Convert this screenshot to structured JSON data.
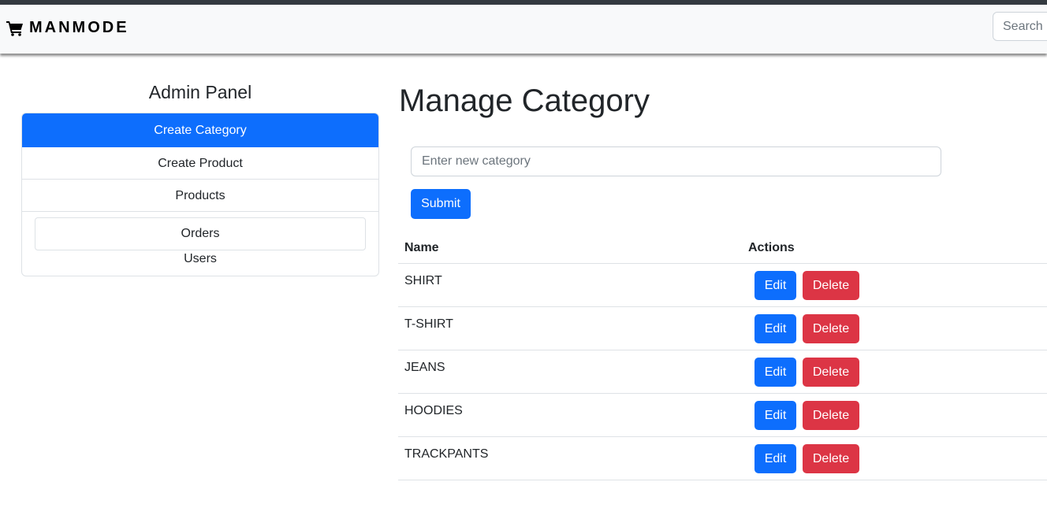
{
  "navbar": {
    "brand": "MANMODE",
    "search_placeholder": "Search"
  },
  "sidebar": {
    "title": "Admin Panel",
    "items": [
      {
        "label": "Create Category",
        "active": true
      },
      {
        "label": "Create Product"
      },
      {
        "label": "Products"
      },
      {
        "label": "Orders"
      },
      {
        "label": "Users"
      }
    ]
  },
  "main": {
    "title": "Manage Category",
    "input_placeholder": "Enter new category",
    "input_value": "",
    "submit_label": "Submit",
    "table": {
      "headers": [
        "Name",
        "Actions"
      ],
      "rows": [
        {
          "name": "SHIRT"
        },
        {
          "name": "T-SHIRT"
        },
        {
          "name": "JEANS"
        },
        {
          "name": "HOODIES"
        },
        {
          "name": "TRACKPANTS"
        }
      ],
      "edit_label": "Edit",
      "delete_label": "Delete"
    }
  },
  "colors": {
    "primary": "#0d6efd",
    "danger": "#dc3545",
    "navbar_bg": "#f8f9fa",
    "top_strip": "#343a40"
  }
}
